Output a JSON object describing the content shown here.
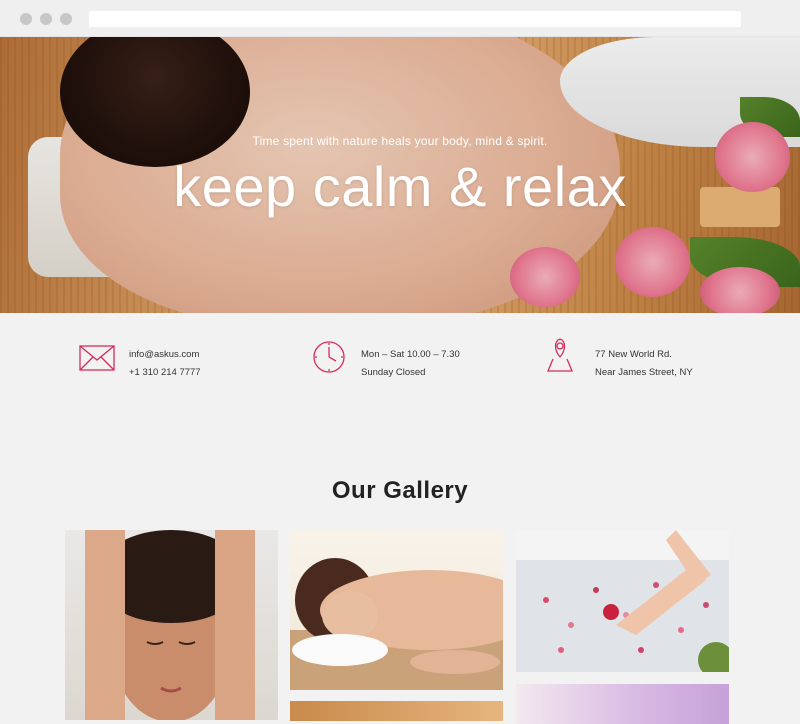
{
  "hero": {
    "subtitle": "Time spent with nature heals your body, mind & spirit.",
    "title": "keep calm & relax"
  },
  "contact": [
    {
      "icon": "envelope-icon",
      "line1": "info@askus.com",
      "line2": "+1 310 214 7777"
    },
    {
      "icon": "clock-icon",
      "line1": "Mon – Sat 10.00 – 7.30",
      "line2": "Sunday Closed"
    },
    {
      "icon": "location-pin-icon",
      "line1": "77 New World Rd.",
      "line2": "Near James Street, NY"
    }
  ],
  "gallery": {
    "title": "Our Gallery"
  },
  "colors": {
    "accent": "#d62d5b",
    "background": "#f2f2f2"
  }
}
